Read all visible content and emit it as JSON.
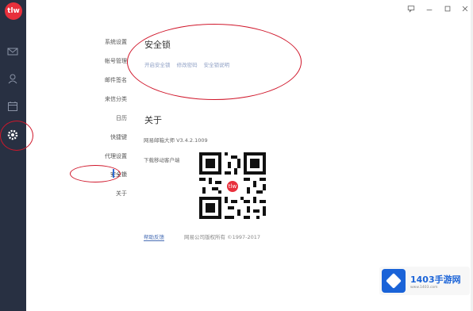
{
  "app": {
    "logo_text": "tlw",
    "rail_icons": [
      "mail-icon",
      "contacts-icon",
      "calendar-icon",
      "settings-icon"
    ]
  },
  "titlebar": {
    "icons": [
      "message-icon",
      "minimize-icon",
      "maximize-icon",
      "close-icon"
    ]
  },
  "settings_nav": {
    "items": [
      {
        "label": "系统设置"
      },
      {
        "label": "帐号管理"
      },
      {
        "label": "邮件签名"
      },
      {
        "label": "来信分类"
      },
      {
        "label": "日历"
      },
      {
        "label": "快捷键"
      },
      {
        "label": "代理设置"
      },
      {
        "label": "安全锁",
        "active": true
      },
      {
        "label": "关于"
      }
    ]
  },
  "security_lock": {
    "title": "安全锁",
    "links": [
      "开启安全锁",
      "修改密码",
      "安全锁说明"
    ]
  },
  "about": {
    "title": "关于",
    "version_text": "网易邮箱大师 V3.4.2.1009",
    "download_label": "下载移动客户端",
    "qr_center_text": "tlw",
    "feedback_link": "帮助反馈",
    "copyright": "网易公司版权所有 ©1997-2017"
  },
  "watermark": {
    "title": "1403手游网",
    "subtitle": "www.1403.com"
  },
  "colors": {
    "rail_bg": "#283042",
    "brand_red": "#e8303c",
    "annotation_red": "#d0172b",
    "link_blue": "#4a6fb5",
    "watermark_blue": "#1a63d8"
  }
}
